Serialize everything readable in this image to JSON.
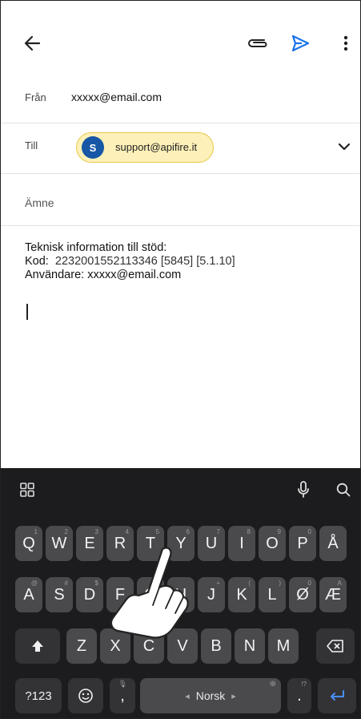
{
  "compose": {
    "from_label": "Från",
    "from_value": "xxxxx@email.com",
    "to_label": "Till",
    "to_chip": {
      "initial": "S",
      "email": "support@apifire.it"
    },
    "subject_label": "Ämne",
    "body": {
      "line1": "Teknisk information till stöd:",
      "kod_label": "Kod:",
      "kod_value": "2232001552113346 [5845] [5.1.10]",
      "user_line": "Användare: xxxxx@email.com"
    }
  },
  "keyboard": {
    "row1": [
      {
        "k": "Q",
        "h": "1"
      },
      {
        "k": "W",
        "h": "2"
      },
      {
        "k": "E",
        "h": "3"
      },
      {
        "k": "R",
        "h": "4"
      },
      {
        "k": "T",
        "h": "5"
      },
      {
        "k": "Y",
        "h": "6"
      },
      {
        "k": "U",
        "h": "7"
      },
      {
        "k": "I",
        "h": "8"
      },
      {
        "k": "O",
        "h": "9"
      },
      {
        "k": "P",
        "h": "0"
      },
      {
        "k": "Å",
        "h": ""
      }
    ],
    "row2": [
      {
        "k": "A",
        "h": "@"
      },
      {
        "k": "S",
        "h": "#"
      },
      {
        "k": "D",
        "h": "$"
      },
      {
        "k": "F",
        "h": ""
      },
      {
        "k": "G",
        "h": ""
      },
      {
        "k": "H",
        "h": ""
      },
      {
        "k": "J",
        "h": "+"
      },
      {
        "k": "K",
        "h": "("
      },
      {
        "k": "L",
        "h": ")"
      },
      {
        "k": "Ø",
        "h": "0"
      },
      {
        "k": "Æ",
        "h": "A"
      }
    ],
    "row3": [
      {
        "k": "Z",
        "h": ""
      },
      {
        "k": "X",
        "h": "\""
      },
      {
        "k": "C",
        "h": ""
      },
      {
        "k": "V",
        "h": ""
      },
      {
        "k": "B",
        "h": ""
      },
      {
        "k": "N",
        "h": ""
      },
      {
        "k": "M",
        "h": ""
      }
    ],
    "symbols_label": "?123",
    "comma": ",",
    "space_label": "Norsk",
    "period": ".",
    "period_hint": "!?"
  },
  "colors": {
    "accent": "#1a73e8",
    "chip_bg": "#fdf0b8",
    "avatar": "#1757a6",
    "keyboard_bg": "#1c1c1e",
    "key": "#4a4a4d"
  }
}
